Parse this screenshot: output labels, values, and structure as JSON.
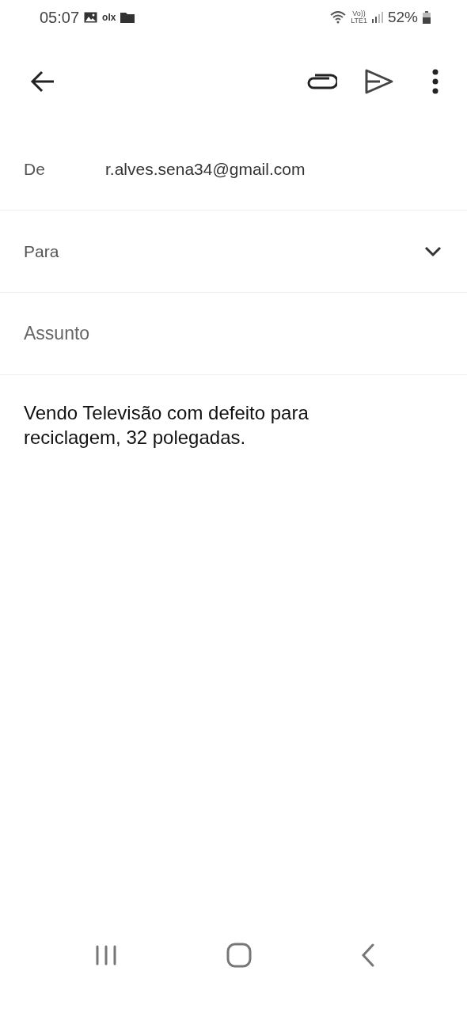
{
  "status_bar": {
    "time": "05:07",
    "notification_text": "olx",
    "network_label": "Vo))\nLTE1",
    "battery": "52%"
  },
  "compose": {
    "from": {
      "label": "De",
      "value": "r.alves.sena34@gmail.com"
    },
    "to": {
      "label": "Para",
      "expanded": false
    },
    "subject": {
      "placeholder": "Assunto"
    },
    "body": "Vendo Televisão com defeito para reciclagem, 32 polegadas."
  }
}
